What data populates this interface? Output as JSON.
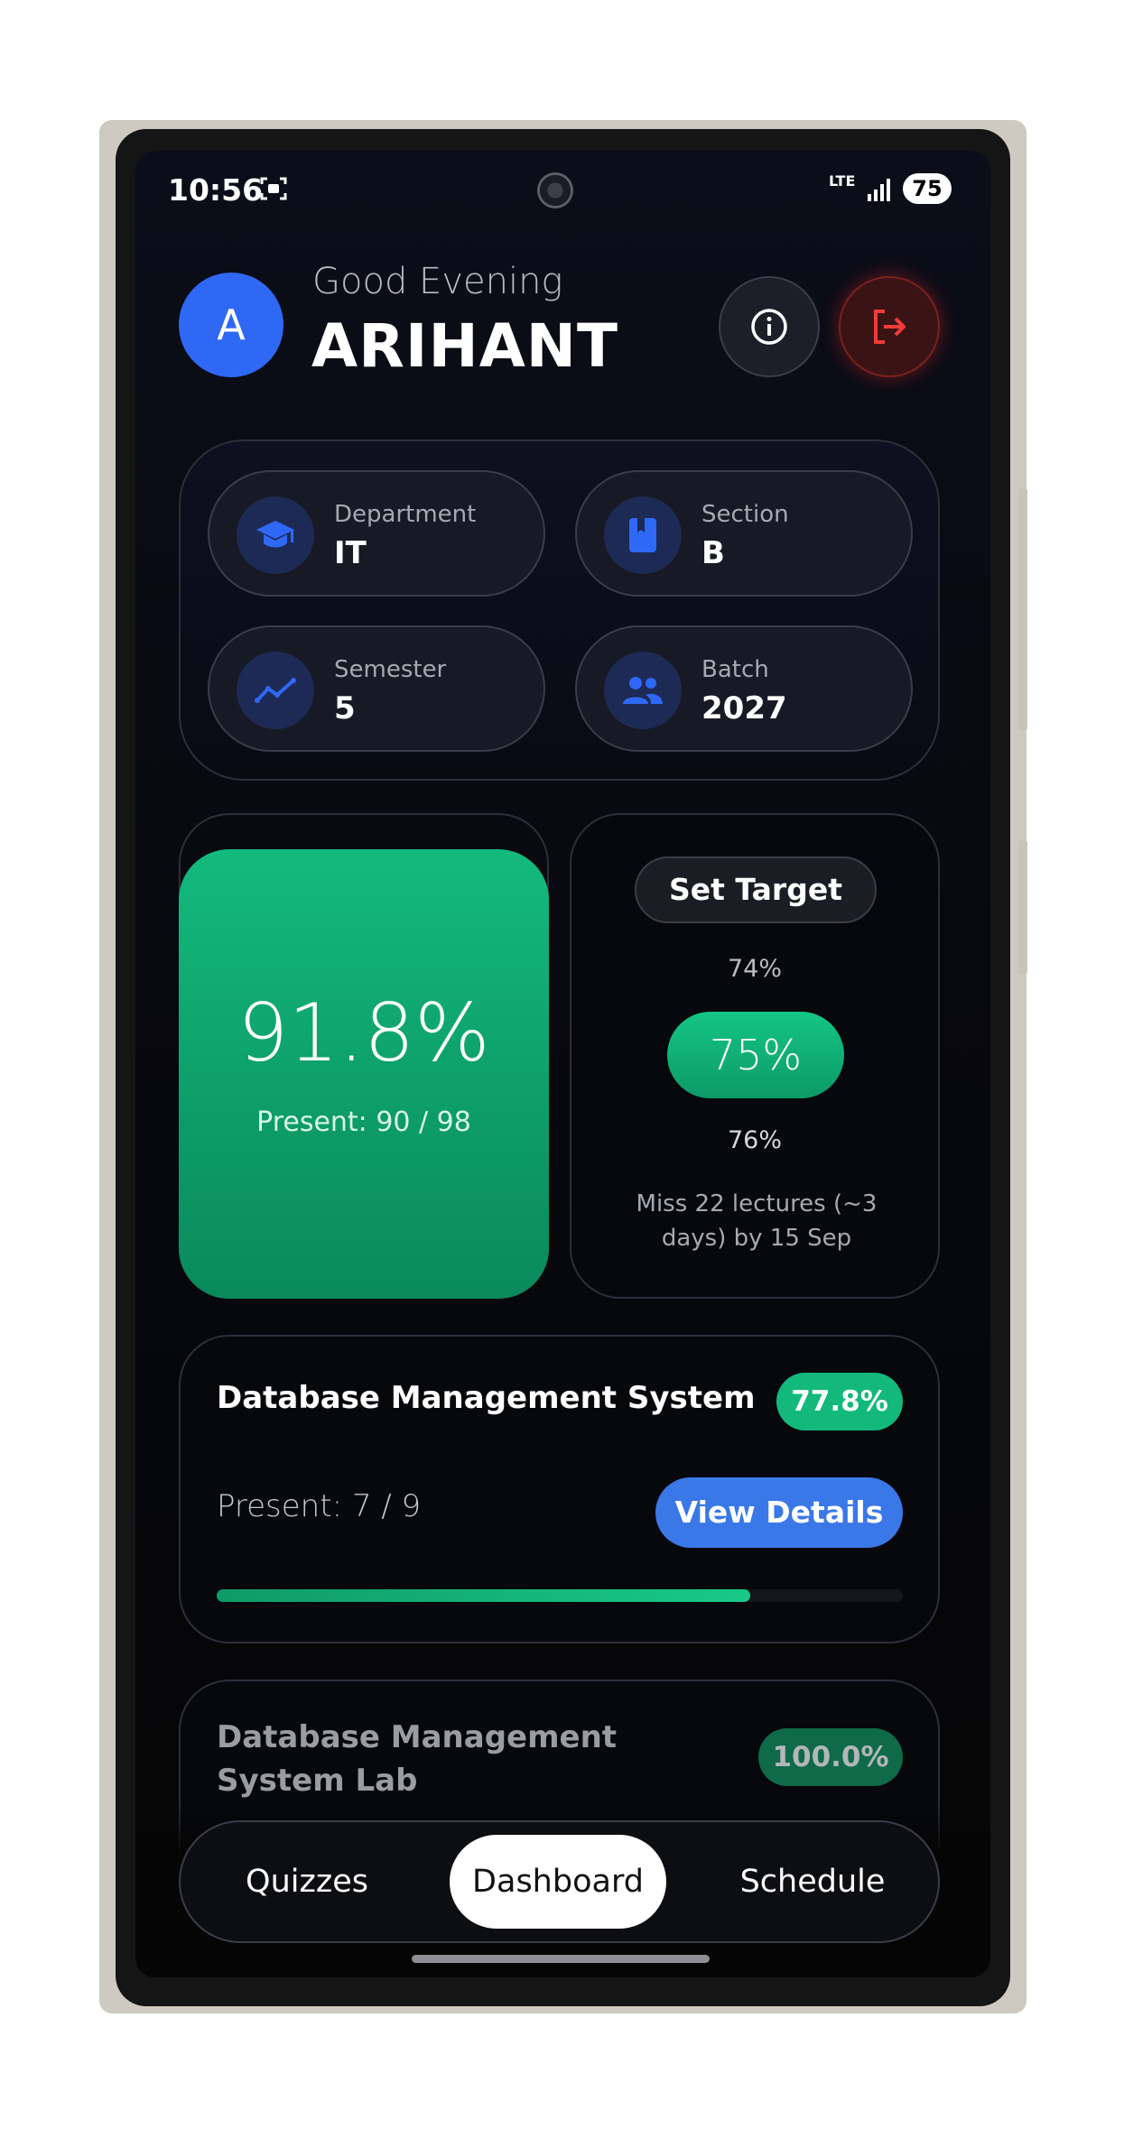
{
  "status_bar": {
    "time": "10:56",
    "network": "LTE",
    "battery": "75"
  },
  "header": {
    "avatar_letter": "A",
    "greeting": "Good Evening",
    "name": "ARIHANT"
  },
  "profile": [
    {
      "label": "Department",
      "value": "IT",
      "icon": "graduation-cap-icon"
    },
    {
      "label": "Section",
      "value": "B",
      "icon": "book-icon"
    },
    {
      "label": "Semester",
      "value": "5",
      "icon": "trend-line-icon"
    },
    {
      "label": "Batch",
      "value": "2027",
      "icon": "users-icon"
    }
  ],
  "attendance": {
    "percent": "91.8%",
    "present": "Present: 90 / 98"
  },
  "target": {
    "button_label": "Set Target",
    "above": "74%",
    "selected": "75%",
    "below": "76%",
    "message": "Miss 22 lectures (~3 days) by 15 Sep"
  },
  "subjects": [
    {
      "name": "Database Management System",
      "percent": "77.8%",
      "present": "Present: 7 / 9",
      "action": "View Details",
      "progress": 0.778
    },
    {
      "name": "Database Management System Lab",
      "percent": "100.0%"
    }
  ],
  "nav": {
    "items": [
      "Quizzes",
      "Dashboard",
      "Schedule"
    ],
    "active": "Dashboard"
  },
  "colors": {
    "accent_green": "#12b97a",
    "accent_blue": "#2e68f5",
    "danger": "#e53935",
    "background": "#07080d"
  }
}
